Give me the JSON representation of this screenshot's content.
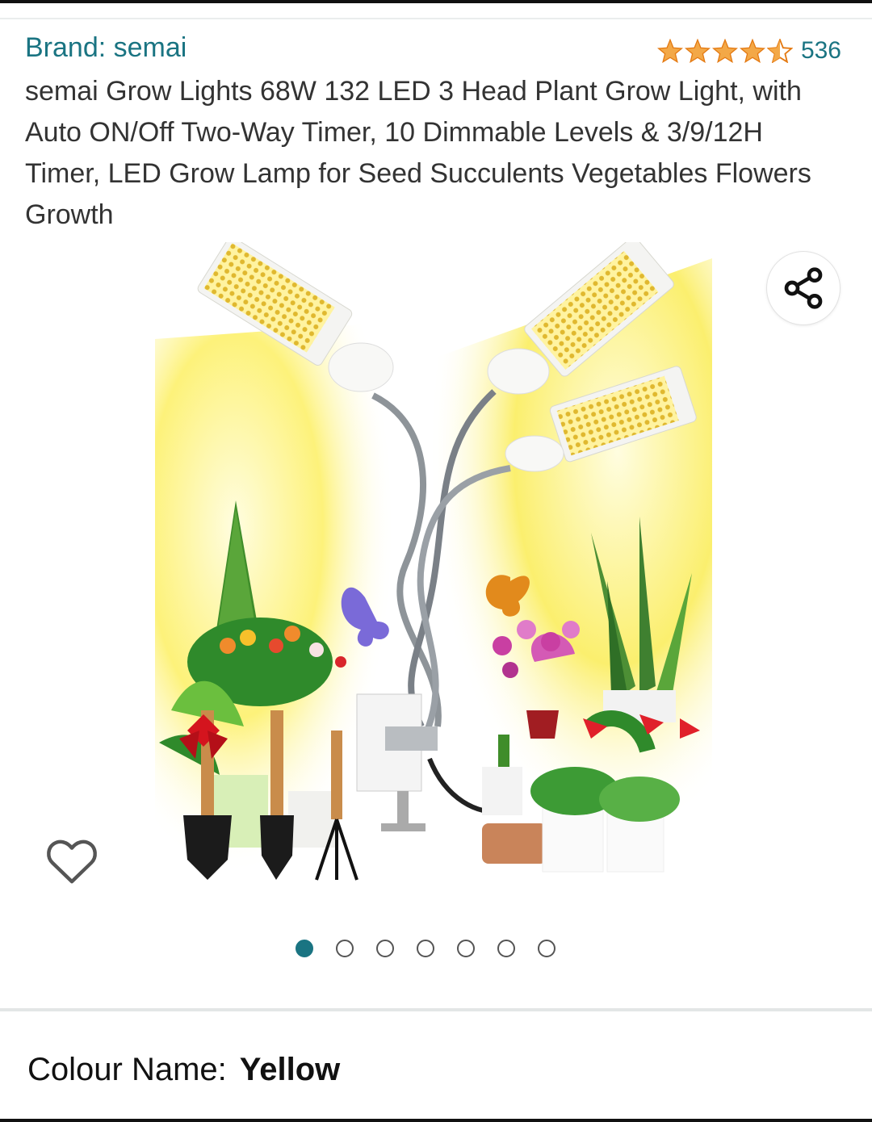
{
  "product": {
    "brand_label": "Brand: semai",
    "rating_value": 4.5,
    "review_count": "536",
    "title": "semai Grow Lights 68W 132 LED 3 Head Plant Grow Light, with Auto ON/Off Two-Way Timer, 10 Dimmable Levels & 3/9/12H Timer, LED Grow Lamp for Seed Succulents Vegetables Flowers Growth",
    "star_color": "#f3a847",
    "link_color": "#1a7482"
  },
  "gallery": {
    "image_count": 7,
    "active_index": 0
  },
  "icons": {
    "share": "share-icon",
    "wishlist": "heart-outline-icon"
  },
  "variation": {
    "label": "Colour Name:",
    "value": "Yellow"
  }
}
